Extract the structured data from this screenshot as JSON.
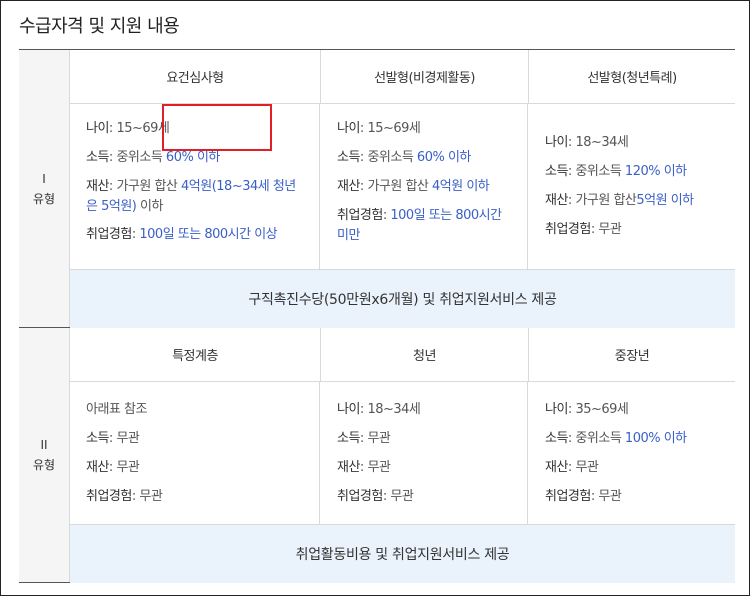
{
  "title": "수급자격 및 지원 내용",
  "type1": {
    "label_roman": "I",
    "label": "유형",
    "columns": [
      {
        "header": "요건심사형",
        "lines": [
          {
            "key": "나이",
            "plain": " 15~69세",
            "hl": ""
          },
          {
            "key": "소득",
            "plain": " 중위소득 ",
            "hl": "60% 이하"
          },
          {
            "key": "재산",
            "plain": " 가구원 합산 ",
            "hl": "4억원(18~34세 청년",
            "hl2": "은 5억원)",
            "tail": " 이하"
          },
          {
            "key": "취업경험",
            "plain": " ",
            "hl": "100일 또는 800시간 이상"
          }
        ]
      },
      {
        "header": "선발형(비경제활동)",
        "lines": [
          {
            "key": "나이",
            "plain": " 15~69세",
            "hl": ""
          },
          {
            "key": "소득",
            "plain": " 중위소득 ",
            "hl": "60% 이하"
          },
          {
            "key": "재산",
            "plain": " 가구원 합산 ",
            "hl": "4억원 이하"
          },
          {
            "key": "취업경험",
            "plain": " ",
            "hl": "100일 또는 800시간",
            "hl2": "미만"
          }
        ]
      },
      {
        "header": "선발형(청년특례)",
        "lines": [
          {
            "key": "나이",
            "plain": " 18~34세",
            "hl": ""
          },
          {
            "key": "소득",
            "plain": " 중위소득 ",
            "hl": "120% 이하"
          },
          {
            "key": "재산",
            "plain": " 가구원 합산",
            "hl": "5억원 이하"
          },
          {
            "key": "취업경험",
            "plain": " 무관",
            "hl": ""
          }
        ]
      }
    ],
    "summary": "구직촉진수당(50만원x6개월) 및 취업지원서비스 제공"
  },
  "type2": {
    "label_roman": "II",
    "label": "유형",
    "columns": [
      {
        "header": "특정계층",
        "lines": [
          {
            "text": "아래표 참조"
          },
          {
            "key": "소득",
            "plain": " 무관"
          },
          {
            "key": "재산",
            "plain": " 무관"
          },
          {
            "key": "취업경험",
            "plain": " 무관"
          }
        ]
      },
      {
        "header": "청년",
        "lines": [
          {
            "key": "나이",
            "plain": " 18~34세"
          },
          {
            "key": "소득",
            "plain": " 무관"
          },
          {
            "key": "재산",
            "plain": " 무관"
          },
          {
            "key": "취업경험",
            "plain": " 무관"
          }
        ]
      },
      {
        "header": "중장년",
        "lines": [
          {
            "key": "나이",
            "plain": " 35~69세"
          },
          {
            "key": "소득",
            "plain": " 중위소득 ",
            "hl": "100% 이하"
          },
          {
            "key": "재산",
            "plain": " 무관"
          },
          {
            "key": "취업경험",
            "plain": " 무관"
          }
        ]
      }
    ],
    "summary": "취업활동비용 및 취업지원서비스 제공"
  },
  "colors": {
    "highlight": "#3a5fc7",
    "summary_bg": "#eaf2fb",
    "annotation": "#e01f26"
  }
}
